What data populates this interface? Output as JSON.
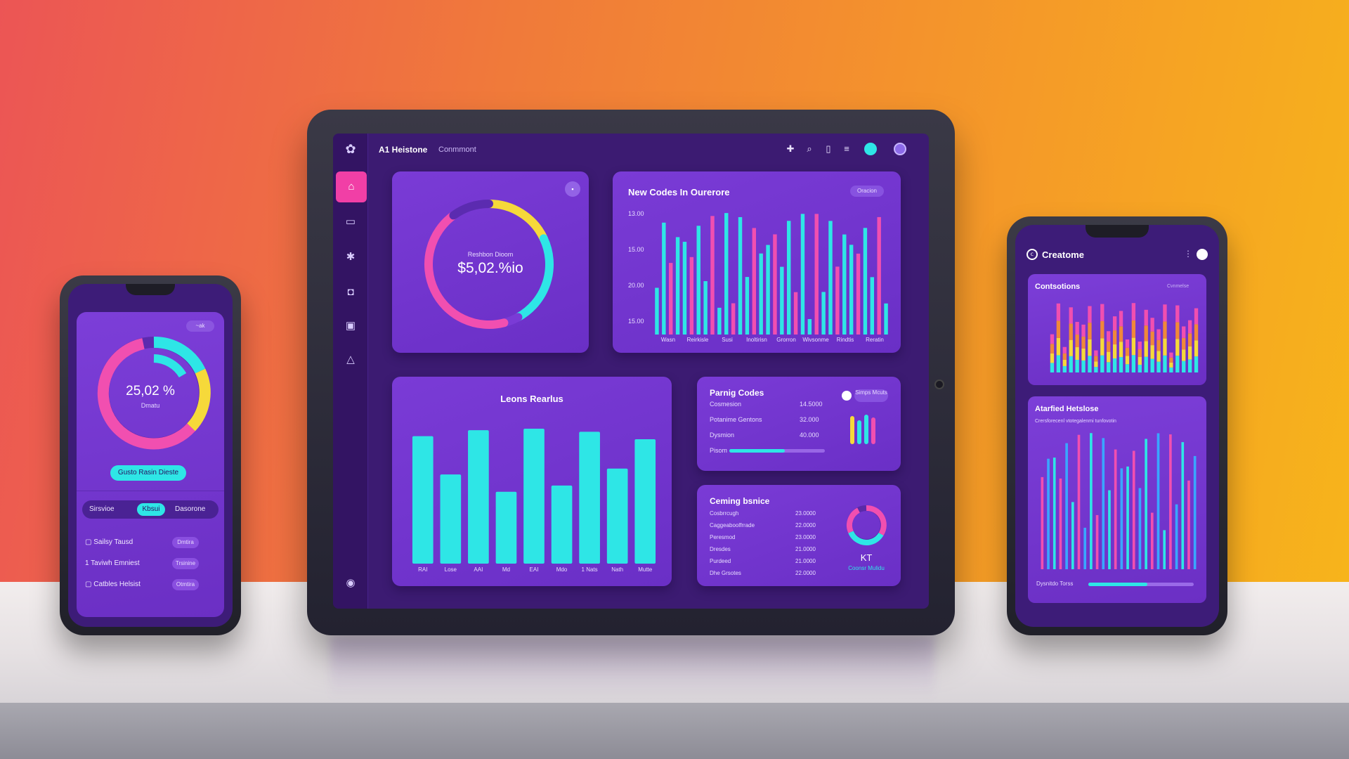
{
  "tablet": {
    "brand": "A1 Heistone",
    "brand_sub": "Conmmont",
    "donut_card": {
      "label": "Reshbon Dioom",
      "value": "$5,02.%io",
      "segments": [
        {
          "color": "#f6d93a",
          "fraction": 0.18
        },
        {
          "color": "#2ee6e6",
          "fraction": 0.24
        },
        {
          "color": "#7a3bd6",
          "fraction": 0.04
        },
        {
          "color": "#f14fb0",
          "fraction": 0.44
        },
        {
          "color": "#5b2bb0",
          "fraction": 0.1
        }
      ]
    },
    "new_codes": {
      "title": "New Codes In Ourerore",
      "badge": "Oracion",
      "y_ticks": [
        "13.00",
        "15.00",
        "20.00",
        "15.00"
      ],
      "x_labels": [
        "Wasn",
        "Reirkisle",
        "Susi",
        "Inoltirisn",
        "Grorron",
        "Wivsonme",
        "Rindtis",
        "Reratin"
      ]
    },
    "leons": {
      "title": "Leons Rearlus",
      "x_labels": [
        "RAI",
        "Lose",
        "AAI",
        "Md",
        "EAI",
        "Mdo",
        "1 Nats",
        "Nath",
        "Mutte"
      ]
    },
    "paring": {
      "title": "Parnig Codes",
      "rows": [
        {
          "label": "Cosmesion",
          "value": "14.5000"
        },
        {
          "label": "Potanime Gentons",
          "value": "32.000"
        },
        {
          "label": "Dysmion",
          "value": "40.000"
        },
        {
          "label": "Pisom",
          "value": ""
        }
      ],
      "toggle_label": "Simps Mcuts"
    },
    "coming": {
      "title": "Ceming bsnice",
      "rows": [
        {
          "label": "Cosbrrcugh",
          "value": "23.0000"
        },
        {
          "label": "Caggeaboolfrrade",
          "value": "22.0000"
        },
        {
          "label": "Peresmod",
          "value": "23.0000"
        },
        {
          "label": "Dresdes",
          "value": "21.0000"
        },
        {
          "label": "Purdeed",
          "value": "21.0000"
        },
        {
          "label": "Dhe Grsotes",
          "value": "22.0000"
        }
      ],
      "mini_label": "KT",
      "mini_sub": "Coonsr Mulidu"
    }
  },
  "phone_left": {
    "chip": "~ak",
    "donut_value": "25,02 %",
    "donut_sub": "Dmatu",
    "cta": "Gusto Rasin Dieste",
    "tabs": [
      "Sirsvioe",
      "Kbsui",
      "Dasorone"
    ],
    "items": [
      {
        "label": "Sailsy Tausd",
        "badge": "Dmtira"
      },
      {
        "label": "Taviwh Emniest",
        "badge": "Trsinine"
      },
      {
        "label": "Catbles Helsist",
        "badge": "Otmtira"
      }
    ]
  },
  "phone_right": {
    "title": "Creatome",
    "chart1_title": "Contsotions",
    "chart1_badge": "Cvnmelse",
    "chart2_title": "Atarfied Hetslose",
    "chart2_sub": "Crersforecenl vtotegalenmi tunfovotin",
    "progress_label": "Dysnitdo Torss"
  },
  "colors": {
    "cyan": "#2ee6e6",
    "pink": "#f14fb0",
    "yellow": "#f6d93a",
    "purple": "#7a3bd6"
  }
}
